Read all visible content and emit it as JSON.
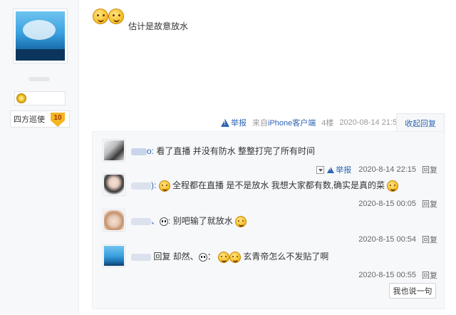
{
  "author": {
    "rank_name": "四方巡使",
    "rank_level": "10"
  },
  "post": {
    "text": "估计是故意放水",
    "tail": {
      "report_label": "举报",
      "source_prefix": "来自",
      "source_client": "iPhone客户端",
      "floor": "4楼",
      "date": "2020-08-14 21:59",
      "collapse_label": "收起回复"
    }
  },
  "replies": [
    {
      "name_suffix": "o:",
      "content": "看了直播 并没有防水 整整打完了所有时间",
      "report_label": "举报",
      "date": "2020-8-14 22:15",
      "reply_label": "回复"
    },
    {
      "name_suffix": "):",
      "content": "全程都在直播 是不是放水 我想大家都有数,确实是真的菜",
      "date": "2020-8-15 00:05",
      "reply_label": "回复"
    },
    {
      "name_suffix": "、",
      "content": "别吧输了就放水",
      "date": "2020-8-15 00:54",
      "reply_label": "回复"
    },
    {
      "content_prefix": "回复 却然、",
      "content_mid": "：",
      "content": "玄青帝怎么不发贴了啊",
      "date": "2020-8-15 00:55",
      "reply_label": "回复"
    }
  ],
  "say_button": "我也说一句",
  "icons": [
    "warning-icon",
    "smile-emoji",
    "panda-emoji",
    "dropdown-icon",
    "rank-badge"
  ],
  "colors": {
    "link": "#2d64b3",
    "panel_bg": "#f7f8fa",
    "badge": "#f5b521"
  }
}
